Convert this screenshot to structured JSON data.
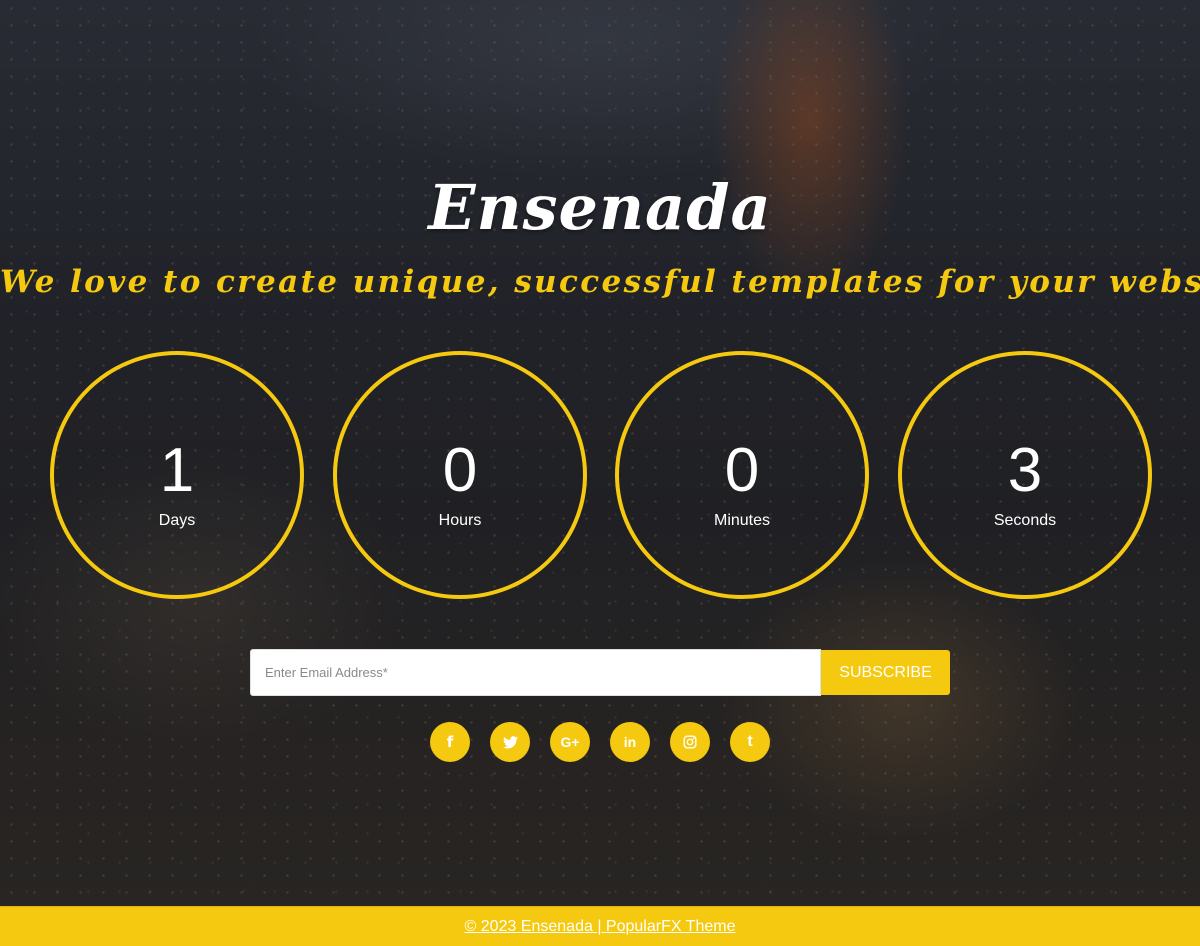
{
  "hero": {
    "brand": "Ensenada",
    "tagline": "We love to create unique, successful templates for your websites"
  },
  "countdown": {
    "days": {
      "value": "1",
      "label": "Days"
    },
    "hours": {
      "value": "0",
      "label": "Hours"
    },
    "minutes": {
      "value": "0",
      "label": "Minutes"
    },
    "seconds": {
      "value": "3",
      "label": "Seconds"
    }
  },
  "subscribe": {
    "placeholder": "Enter Email Address*",
    "button_label": "SUBSCRIBE"
  },
  "social": {
    "icons": [
      "facebook-icon",
      "twitter-icon",
      "google-plus-icon",
      "linkedin-icon",
      "instagram-icon",
      "tumblr-icon"
    ],
    "google_plus_glyph": "G+",
    "linkedin_glyph": "in",
    "tumblr_glyph": "t",
    "facebook_glyph": "f"
  },
  "footer": {
    "credit": "© 2023 Ensenada | PopularFX Theme"
  },
  "colors": {
    "accent": "#f5c90f",
    "text_light": "#ffffff"
  }
}
